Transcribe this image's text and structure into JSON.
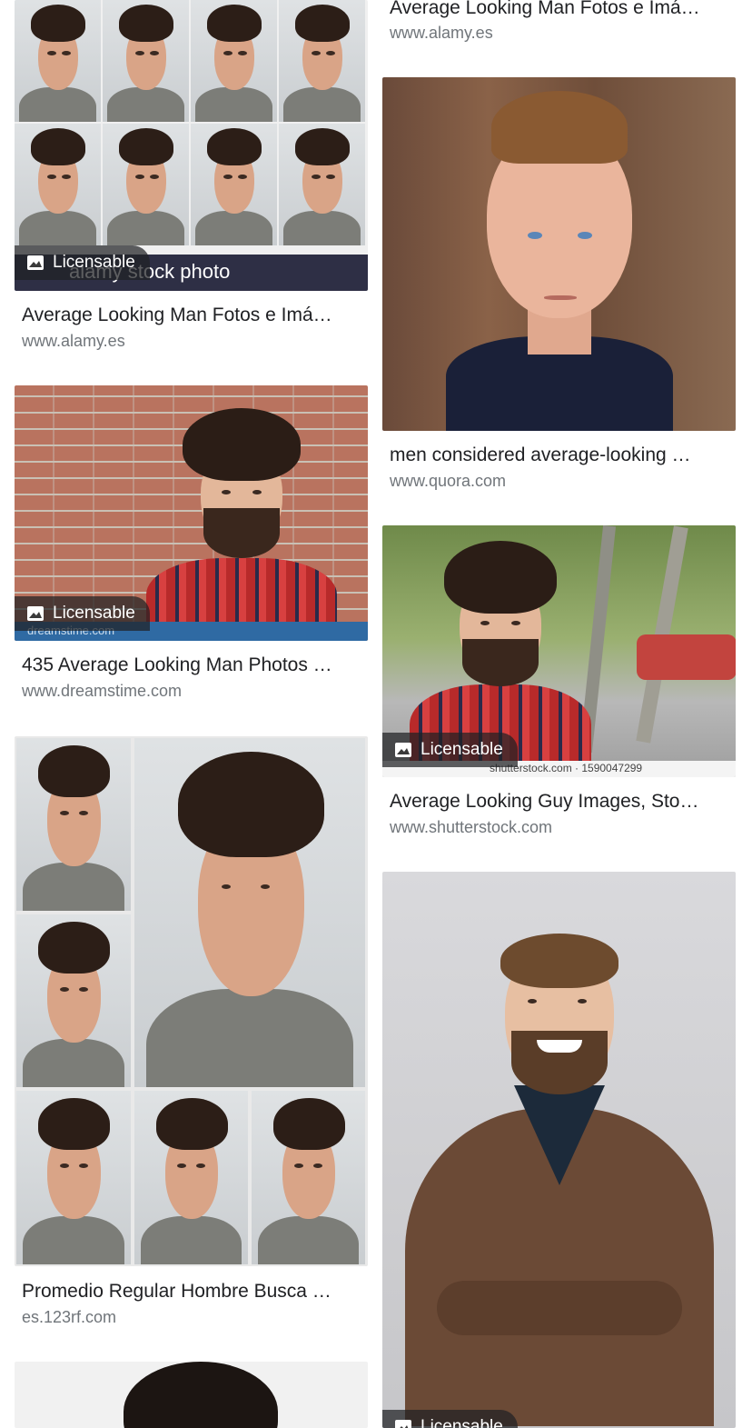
{
  "results": [
    {
      "caption": "Average Looking Man Fotos e Imá…",
      "source": "www.alamy.es",
      "badge": "Licensable",
      "watermark": "alamy stock photo"
    },
    {
      "caption": "Average Looking Man Fotos e Imá…",
      "source": "www.alamy.es"
    },
    {
      "caption": "men considered average-looking …",
      "source": "www.quora.com"
    },
    {
      "caption": "435 Average Looking Man Photos …",
      "source": "www.dreamstime.com",
      "badge": "Licensable",
      "watermark": "dreamstime.com"
    },
    {
      "caption": "Average Looking Guy Images, Sto…",
      "source": "www.shutterstock.com",
      "badge": "Licensable",
      "watermark": "shutterstock.com · 1590047299"
    },
    {
      "caption": "Promedio Regular Hombre Busca …",
      "source": "es.123rf.com"
    },
    {
      "badge": "Licensable"
    }
  ],
  "icons": {
    "badge_icon": "image-icon"
  }
}
